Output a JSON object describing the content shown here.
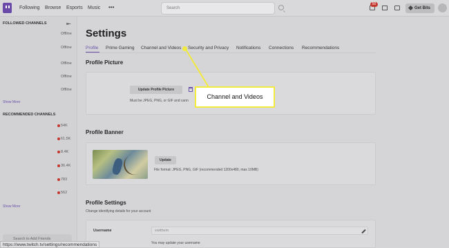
{
  "topnav": {
    "items": [
      "Following",
      "Browse",
      "Esports",
      "Music"
    ],
    "more": "•••",
    "search_placeholder": "Search",
    "notification_count": "50",
    "get_bits": "Get Bits"
  },
  "sidebar": {
    "followed_header": "FOLLOWED CHANNELS",
    "followed_status": [
      "Offline",
      "Offline",
      "Offline",
      "Offline",
      "Offline"
    ],
    "show_more_1": "Show More",
    "recommended_header": "RECOMMENDED CHANNELS",
    "recommended_viewers": [
      "54K",
      "61.5K",
      "8.4K",
      "36.4K",
      "783",
      "562"
    ],
    "show_more_2": "Show More",
    "add_friends": "Search to Add Friends"
  },
  "status_url": "https://www.twitch.tv/settings/recommendations",
  "page_title": "Settings",
  "tabs": [
    "Profile",
    "Prime Gaming",
    "Channel and Videos",
    "Security and Privacy",
    "Notifications",
    "Connections",
    "Recommendations"
  ],
  "profile_picture": {
    "heading": "Profile Picture",
    "button": "Update Profile Picture",
    "note": "Must be JPEG, PNG, or GIF and cann"
  },
  "profile_banner": {
    "heading": "Profile Banner",
    "button": "Update",
    "note": "File format: JPEG, PNG, GIF (recommended 1200x480, max 10MB)"
  },
  "profile_settings": {
    "heading": "Profile Settings",
    "subtitle": "Change identifying details for your account",
    "username_label": "Username",
    "username_value": "xwithem",
    "username_hint": "You may update your username"
  },
  "callout": {
    "text": "Channel and Videos",
    "color": "#f2ea3f"
  },
  "colors": {
    "accent": "#6a52a9",
    "live": "#c4372f"
  }
}
